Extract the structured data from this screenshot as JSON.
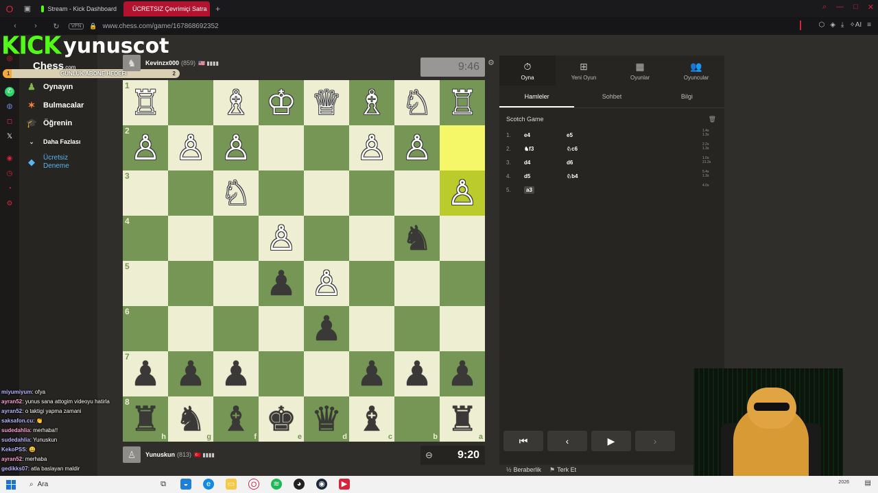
{
  "browser": {
    "tabs": [
      {
        "label": "Stream - Kick Dashboard",
        "active": false
      },
      {
        "label": "ÜCRETSIZ Çevrimiçi Satra",
        "active": true
      }
    ],
    "url": "www.chess.com/game/167868692352",
    "vpn_label": "VPN",
    "ai_label": "AI"
  },
  "stream_overlay": {
    "platform": "KICK",
    "channel": "yunuscot",
    "goal_label": "GÜNLÜK ABONE HEDEFİ",
    "goal_start": "1",
    "goal_value": "2",
    "goal_progress": 0.05
  },
  "sidebar": {
    "logo": "Chess",
    "logo_suffix": ".com",
    "items": [
      {
        "label": "Oynayın",
        "icon": "pawn-play-icon"
      },
      {
        "label": "Bulmacalar",
        "icon": "puzzle-icon"
      },
      {
        "label": "Öğrenin",
        "icon": "learn-icon"
      },
      {
        "label": "Daha Fazlası",
        "icon": "chevron-down-icon"
      },
      {
        "label": "Ücretsiz Deneme",
        "icon": "diamond-icon"
      }
    ]
  },
  "game": {
    "top_player": {
      "name": "Kevinzx000",
      "rating": "(859)",
      "clock": "9:46"
    },
    "bottom_player": {
      "name": "Yunuskun",
      "rating": "(813)",
      "clock": "9:20"
    },
    "board": [
      [
        "♖",
        "",
        "♗",
        "♔",
        "♕",
        "♗",
        "♘",
        "♖"
      ],
      [
        "♙",
        "♙",
        "♙",
        "",
        "",
        "♙",
        "♙",
        ""
      ],
      [
        "",
        "",
        "♘",
        "",
        "",
        "",
        "",
        "♙"
      ],
      [
        "",
        "",
        "",
        "♙",
        "",
        "",
        "♞",
        ""
      ],
      [
        "",
        "",
        "",
        "♟",
        "♙",
        "",
        "",
        ""
      ],
      [
        "",
        "",
        "",
        "",
        "♟",
        "",
        "",
        ""
      ],
      [
        "♟",
        "♟",
        "♟",
        "",
        "",
        "♟",
        "♟",
        "♟"
      ],
      [
        "♜",
        "♞",
        "♝",
        "♚",
        "♛",
        "♝",
        "",
        "♜"
      ]
    ],
    "board_colors": [
      "w",
      "",
      "w",
      "w",
      "w",
      "w",
      "w",
      "w",
      "w",
      "w",
      "w",
      "",
      "",
      "w",
      "w",
      "",
      "",
      "",
      "w",
      "",
      "",
      "",
      "",
      "w",
      "",
      "",
      "",
      "w",
      "",
      "",
      "b",
      "",
      "",
      "",
      "",
      "b",
      "w",
      "",
      "",
      "",
      "",
      "",
      "",
      "",
      "b",
      "",
      "",
      "",
      "b",
      "b",
      "b",
      "",
      "",
      "b",
      "b",
      "b",
      "b",
      "b",
      "b",
      "b",
      "b",
      "b",
      "",
      "b"
    ],
    "ranks": [
      "1",
      "2",
      "3",
      "4",
      "5",
      "6",
      "7",
      "8"
    ],
    "files": [
      "h",
      "g",
      "f",
      "e",
      "d",
      "c",
      "b",
      "a"
    ],
    "highlights": [
      [
        1,
        7
      ],
      [
        2,
        7
      ]
    ]
  },
  "panel": {
    "tabs": [
      {
        "label": "Oyna",
        "icon": "stopwatch-icon"
      },
      {
        "label": "Yeni Oyun",
        "icon": "plus-icon"
      },
      {
        "label": "Oyunlar",
        "icon": "board-icon"
      },
      {
        "label": "Oyuncular",
        "icon": "players-icon"
      }
    ],
    "subtabs": [
      "Hamleler",
      "Sohbet",
      "Bilgi"
    ],
    "opening": "Scotch Game",
    "moves": [
      {
        "num": "1.",
        "white": "e4",
        "black": "e5",
        "times": [
          "1.4s",
          "1.3s"
        ]
      },
      {
        "num": "2.",
        "white": "♞f3",
        "black": "♘c6",
        "times": [
          "2.2s",
          "1.3s"
        ]
      },
      {
        "num": "3.",
        "white": "d4",
        "black": "d6",
        "times": [
          "1.0s",
          "21.2s"
        ]
      },
      {
        "num": "4.",
        "white": "d5",
        "black": "♘b4",
        "times": [
          "5.4s",
          "1.3s"
        ]
      },
      {
        "num": "5.",
        "white": "a3",
        "black": "",
        "times": [
          "4.0s",
          ""
        ]
      }
    ],
    "actions": [
      {
        "label": "Beraberlik",
        "icon": "draw-icon"
      },
      {
        "label": "Terk Et",
        "icon": "flag-icon"
      }
    ]
  },
  "chat": [
    {
      "user": "miyumiyum",
      "text": ": ofya"
    },
    {
      "user": "ayran52",
      "text": ": yunus sana attogim videoyu hatirla"
    },
    {
      "user": "ayran52",
      "text": ": o taktigi yapma zamani"
    },
    {
      "user": "saksafon.cu",
      "text": ": 👏"
    },
    {
      "user": "sudedahlia",
      "text": ": merhaba!!"
    },
    {
      "user": "sudedahlia",
      "text": ": Yunuskun"
    },
    {
      "user": "KekoPSS",
      "text": ": 😀"
    },
    {
      "user": "ayran52",
      "text": ": merhaba"
    },
    {
      "user": "gedikks07",
      "text": ": atla baslayan maldir"
    }
  ],
  "taskbar": {
    "search": "Ara",
    "date": "2026"
  }
}
